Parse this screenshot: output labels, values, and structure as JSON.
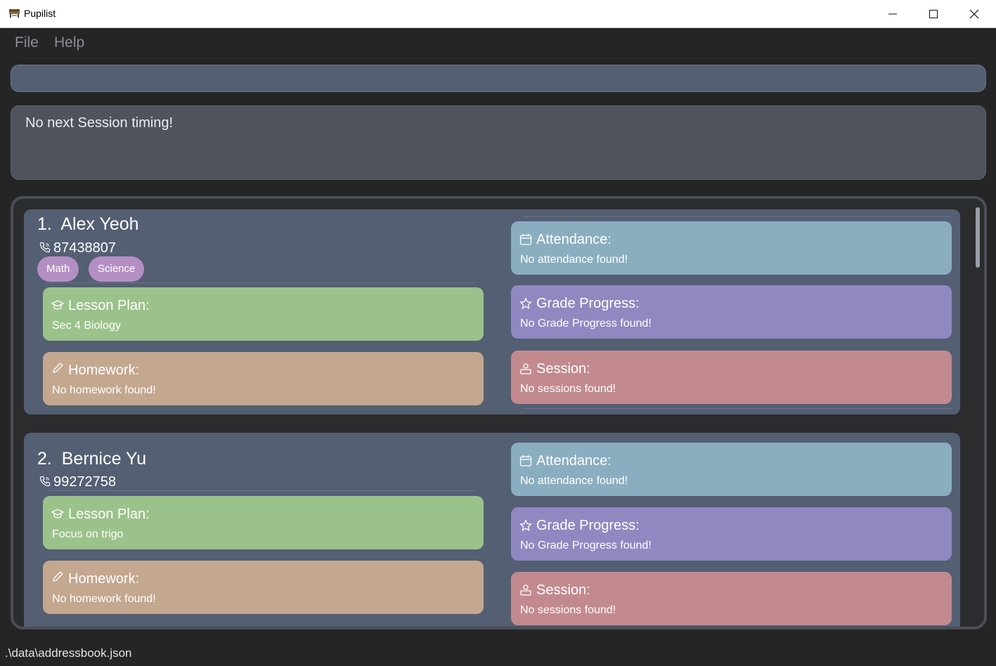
{
  "window": {
    "title": "Pupilist"
  },
  "menu": {
    "file": "File",
    "help": "Help"
  },
  "command": {
    "value": ""
  },
  "result": {
    "text": "No next Session timing!"
  },
  "persons": [
    {
      "name": "1.  Alex Yeoh",
      "phone": "87438807",
      "tags": [
        "Math",
        "Science"
      ],
      "lesson_title": "Lesson Plan:",
      "lesson_text": "Sec 4 Biology",
      "homework_title": "Homework:",
      "homework_text": "No homework found!",
      "attendance_title": "Attendance:",
      "attendance_text": "No attendance found!",
      "grade_title": "Grade Progress:",
      "grade_text": "No Grade Progress found!",
      "session_title": "Session:",
      "session_text": "No sessions found!"
    },
    {
      "name": "2.  Bernice Yu",
      "phone": "99272758",
      "tags": [],
      "lesson_title": "Lesson Plan:",
      "lesson_text": "Focus on trigo",
      "homework_title": "Homework:",
      "homework_text": "No homework found!",
      "attendance_title": "Attendance:",
      "attendance_text": "No attendance found!",
      "grade_title": "Grade Progress:",
      "grade_text": "No Grade Progress found!",
      "session_title": "Session:",
      "session_text": "No sessions found!"
    }
  ],
  "status": {
    "path": ".\\data\\addressbook.json"
  }
}
